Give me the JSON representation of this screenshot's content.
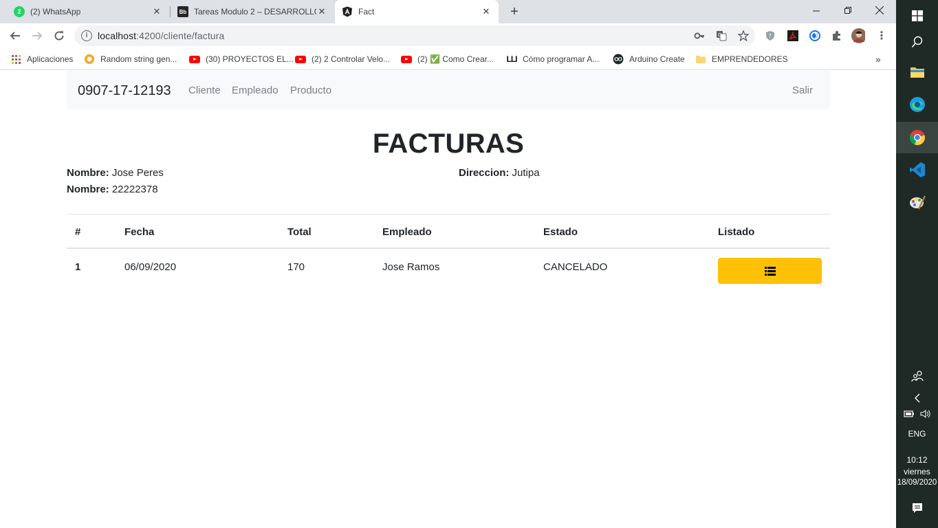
{
  "browser": {
    "tabs": [
      {
        "title": "(2) WhatsApp",
        "favicon": "whatsapp-icon",
        "badge": "2"
      },
      {
        "title": "Tareas Modulo 2 – DESARROLLO WEB",
        "favicon": "blackboard-icon",
        "badge": "Bb"
      },
      {
        "title": "Fact",
        "favicon": "angular-icon",
        "active": true
      }
    ],
    "address": {
      "host": "localhost",
      "rest": ":4200/cliente/factura"
    },
    "bookmarks": [
      {
        "label": "Aplicaciones",
        "icon": "apps-grid-icon"
      },
      {
        "label": "Random string gen...",
        "icon": "random-string-icon"
      },
      {
        "label": "(30) PROYECTOS EL...",
        "icon": "youtube-icon"
      },
      {
        "label": "(2) 2 Controlar Velo...",
        "icon": "youtube-icon"
      },
      {
        "label": "(2) ✅ Como Crear...",
        "icon": "youtube-icon"
      },
      {
        "label": "Cómo programar A...",
        "icon": "lli-icon"
      },
      {
        "label": "Arduino Create",
        "icon": "arduino-icon"
      },
      {
        "label": "EMPRENDEDORES",
        "icon": "folder-icon"
      }
    ],
    "more_bookmarks": "»"
  },
  "app": {
    "brand": "0907-17-12193",
    "nav": [
      "Cliente",
      "Empleado",
      "Producto"
    ],
    "logout": "Salir",
    "heading": "FACTURAS",
    "client": {
      "name_label": "Nombre:",
      "name_value": "Jose Peres",
      "nit_label": "Nombre:",
      "nit_value": "22222378",
      "address_label": "Direccion:",
      "address_value": "Jutipa"
    },
    "table": {
      "headers": [
        "#",
        "Fecha",
        "Total",
        "Empleado",
        "Estado",
        "Listado"
      ],
      "rows": [
        {
          "num": "1",
          "fecha": "06/09/2020",
          "total": "170",
          "empleado": "Jose Ramos",
          "estado": "CANCELADO",
          "action_icon": "list-icon"
        }
      ]
    }
  },
  "taskbar": {
    "language": "ENG",
    "time": "10:12",
    "day": "viernes",
    "date": "18/09/2020"
  },
  "colors": {
    "tabstrip": "#dee1e6",
    "navbar": "#f8f9fa",
    "warning_button": "#ffc107",
    "taskbar": "#1f2a26"
  }
}
